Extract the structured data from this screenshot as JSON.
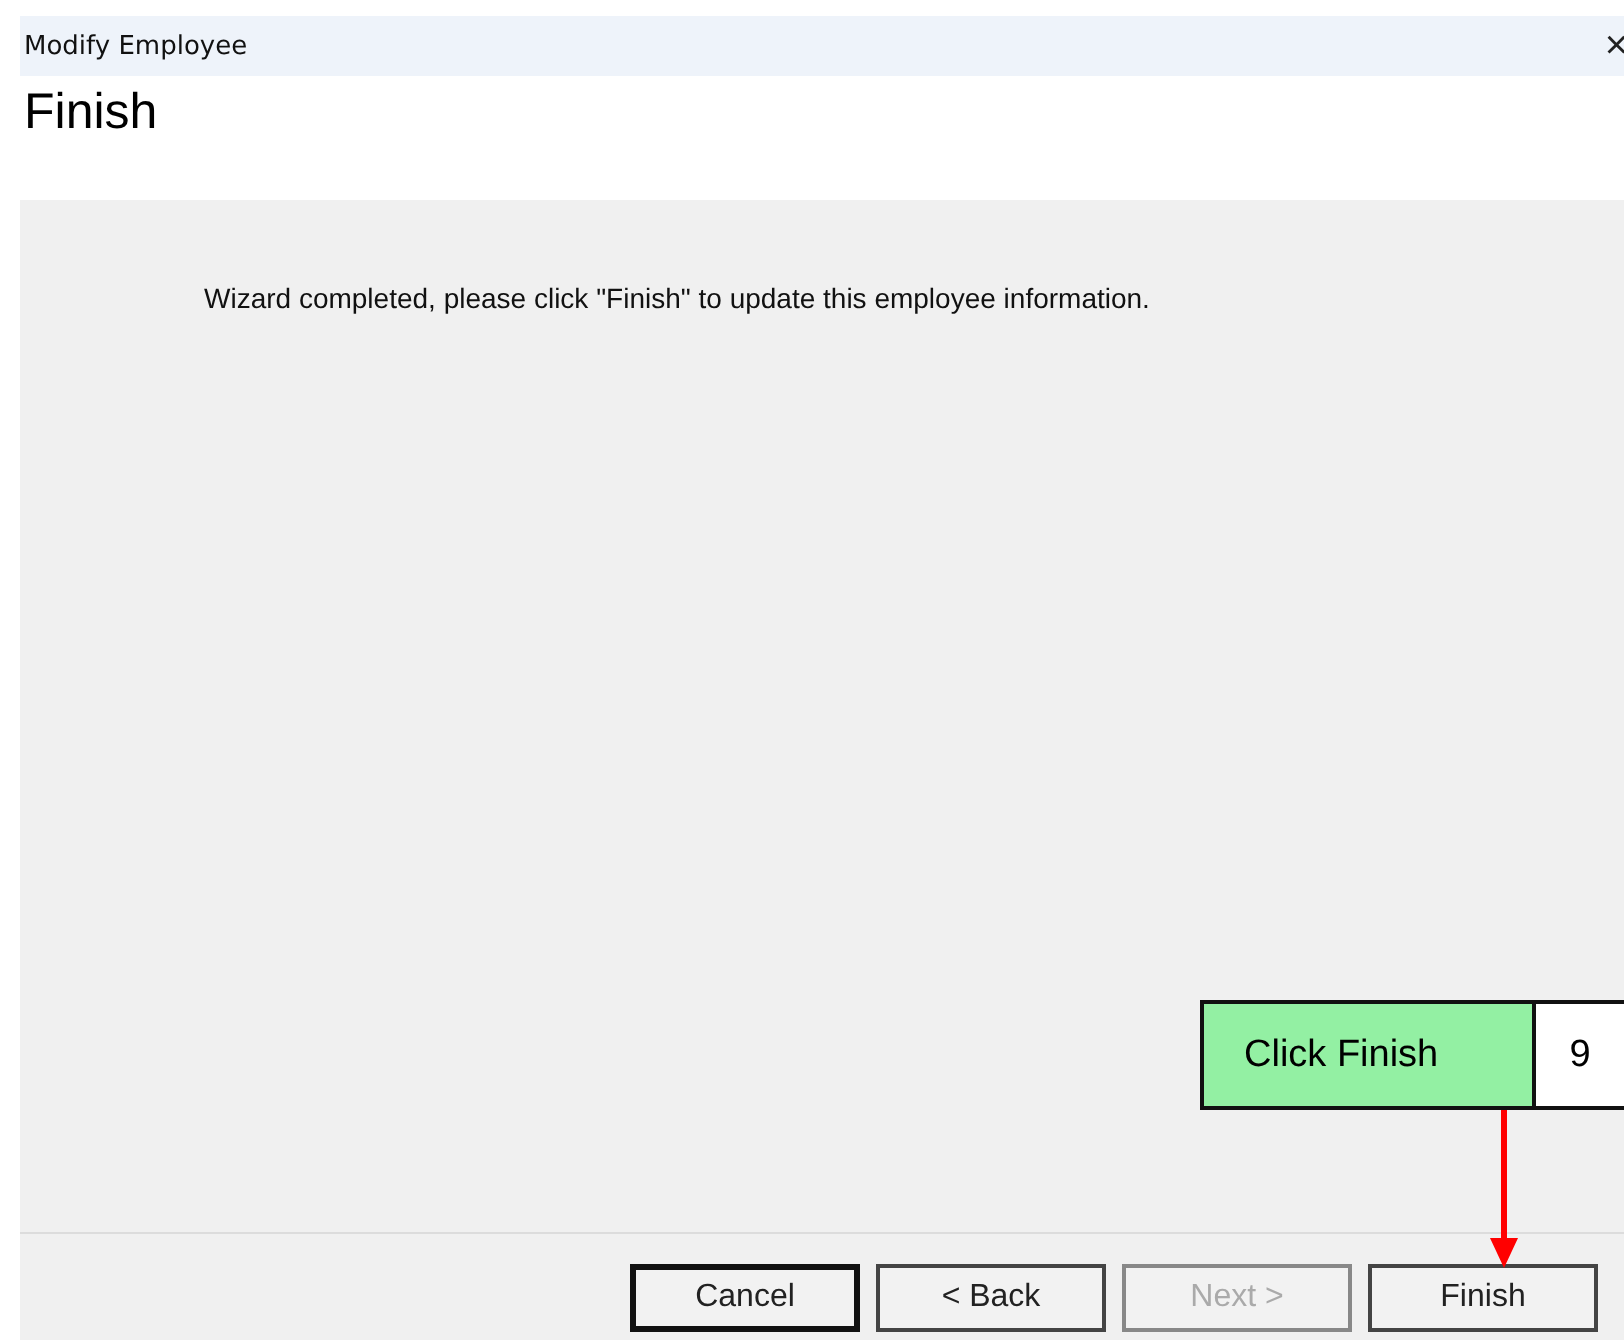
{
  "window": {
    "title": "Modify Employee",
    "close": "×"
  },
  "header": {
    "title": "Finish"
  },
  "message": "Wizard completed, please click \"Finish\" to update this employee information.",
  "buttons": [
    {
      "label": "Cancel",
      "default": true,
      "disabled": false
    },
    {
      "label": "< Back",
      "default": false,
      "disabled": false
    },
    {
      "label": "Next >",
      "default": false,
      "disabled": true
    },
    {
      "label": "Finish",
      "default": false,
      "disabled": false
    }
  ],
  "callout": {
    "text": "Click Finish",
    "step": "9"
  }
}
